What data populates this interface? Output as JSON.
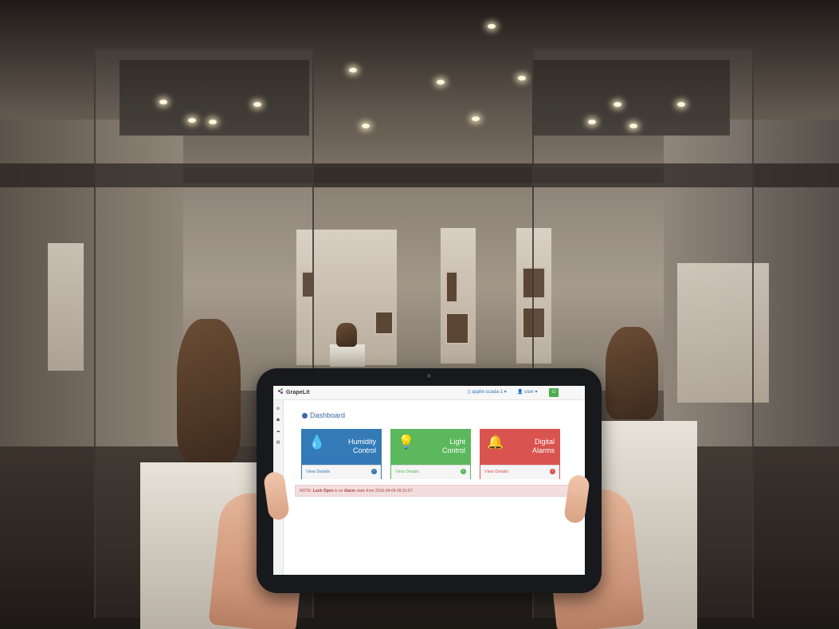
{
  "app": {
    "name": "GrapeLit",
    "device_selector": "applix-scada-1",
    "user_menu": "user",
    "page_title": "Dashboard"
  },
  "cards": [
    {
      "title_line1": "Humidity",
      "title_line2": "Control",
      "link": "View Details",
      "color": "#337ab7",
      "icon": "water-drop-icon"
    },
    {
      "title_line1": "Light",
      "title_line2": "Control",
      "link": "View Details",
      "color": "#5cb85c",
      "icon": "lightbulb-icon"
    },
    {
      "title_line1": "Digital",
      "title_line2": "Alarms",
      "link": "View Details",
      "color": "#d9534f",
      "icon": "bell-icon"
    }
  ],
  "alert": {
    "prefix": "NOTE:",
    "item": "Lock Open",
    "middle1": "is on",
    "state": "Alarm",
    "middle2": "state from 2016-04-04 09:31:07."
  },
  "colors": {
    "primary": "#337ab7",
    "success": "#5cb85c",
    "danger": "#d9534f",
    "alert_bg": "#f2dede"
  }
}
